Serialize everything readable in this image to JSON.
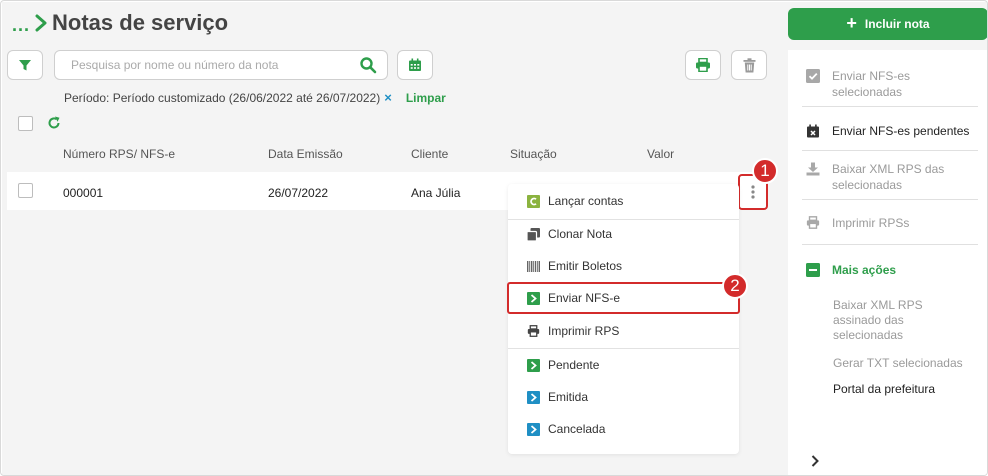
{
  "header": {
    "breadcrumb_dots": "...",
    "title": "Notas de serviço"
  },
  "search": {
    "placeholder": "Pesquisa por nome ou número da nota"
  },
  "filter": {
    "period_text": "Período: Período customizado (26/06/2022 até 26/07/2022)",
    "clear_icon": "×",
    "clear_label": "Limpar"
  },
  "table": {
    "columns": [
      "Número RPS/ NFS-e",
      "Data Emissão",
      "Cliente",
      "Situação",
      "Valor"
    ],
    "rows": [
      {
        "numero": "000001",
        "data": "26/07/2022",
        "cliente": "Ana Júlia"
      }
    ]
  },
  "context_menu": {
    "items": [
      {
        "label": "Lançar contas",
        "icon": "c-square-icon"
      },
      {
        "label": "Clonar Nota",
        "icon": "clone-icon"
      },
      {
        "label": "Emitir Boletos",
        "icon": "barcode-icon"
      },
      {
        "label": "Enviar NFS-e",
        "icon": "send-icon"
      },
      {
        "label": "Imprimir RPS",
        "icon": "printer-icon"
      },
      {
        "label": "Pendente",
        "icon": "status-green-icon"
      },
      {
        "label": "Emitida",
        "icon": "status-blue-icon"
      },
      {
        "label": "Cancelada",
        "icon": "status-blue-icon"
      }
    ]
  },
  "callouts": {
    "one": "1",
    "two": "2"
  },
  "sidebar": {
    "include_label": "Incluir nota",
    "include_plus": "+",
    "items": [
      {
        "label": "Enviar NFS-es selecionadas",
        "enabled": false
      },
      {
        "label": "Enviar NFS-es pendentes",
        "enabled": true
      },
      {
        "label": "Baixar XML RPS das selecionadas",
        "enabled": false
      },
      {
        "label": "Imprimir RPSs",
        "enabled": false
      }
    ],
    "more_actions": "Mais ações",
    "sub_items": [
      {
        "label": "Baixar XML RPS assinado das selecionadas",
        "enabled": false
      },
      {
        "label": "Gerar TXT selecionadas",
        "enabled": false
      },
      {
        "label": "Portal da prefeitura",
        "enabled": true
      }
    ]
  },
  "colors": {
    "accent_green": "#2e9e4b",
    "accent_blue": "#1f8fc4",
    "highlight_red": "#d32b2b",
    "disabled_text": "#9a9a9a"
  }
}
